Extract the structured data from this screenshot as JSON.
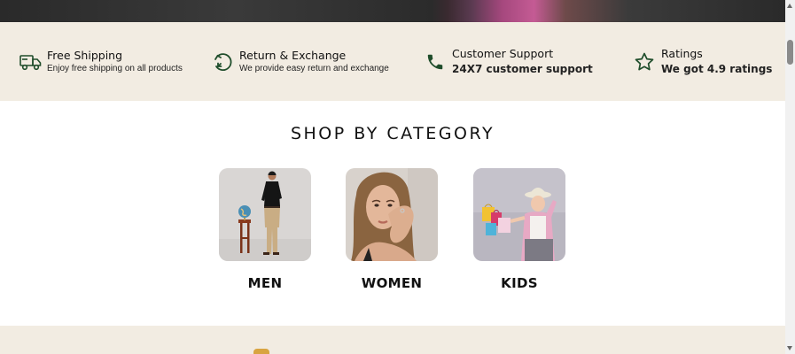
{
  "features": [
    {
      "title": "Free Shipping",
      "desc": "Enjoy free shipping on all products",
      "icon": "truck-icon"
    },
    {
      "title": "Return & Exchange",
      "desc": "We provide easy return and exchange",
      "icon": "return-arrow-icon"
    },
    {
      "title": "Customer Support",
      "desc": "24X7 customer support",
      "icon": "phone-icon"
    },
    {
      "title": "Ratings",
      "desc": "We got 4.9 ratings",
      "icon": "star-icon"
    }
  ],
  "colors": {
    "accent": "#1f4d2b",
    "band": "#f2ece2"
  },
  "section": {
    "title": "SHOP BY CATEGORY"
  },
  "categories": [
    {
      "label": "MEN"
    },
    {
      "label": "WOMEN"
    },
    {
      "label": "KIDS"
    }
  ]
}
